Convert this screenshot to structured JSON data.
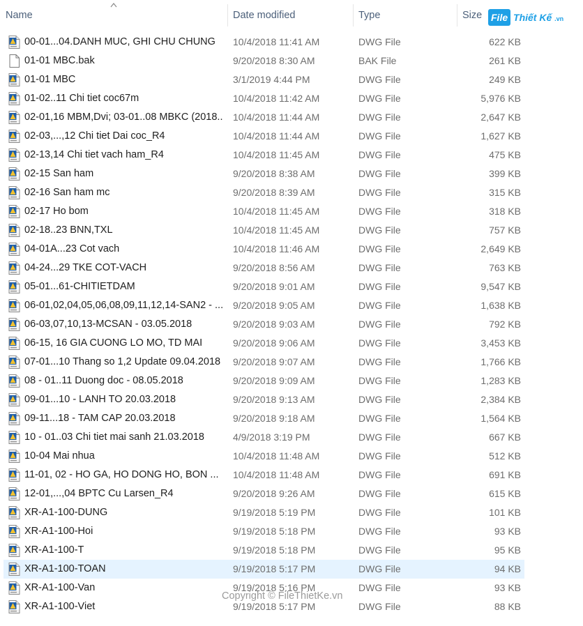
{
  "columns": {
    "name": "Name",
    "date": "Date modified",
    "type": "Type",
    "size": "Size"
  },
  "watermark": {
    "badge": "File",
    "text": "Thiết Kế",
    "tld": ".vn"
  },
  "copyright": "Copyright © FileThietKe.vn",
  "files": [
    {
      "name": "00-01...04.DANH MUC, GHI CHU CHUNG",
      "date": "10/4/2018 11:41 AM",
      "type": "DWG File",
      "size": "622 KB",
      "icon": "dwg-icon"
    },
    {
      "name": "01-01 MBC.bak",
      "date": "9/20/2018 8:30 AM",
      "type": "BAK File",
      "size": "261 KB",
      "icon": "blank-file-icon"
    },
    {
      "name": "01-01 MBC",
      "date": "3/1/2019 4:44 PM",
      "type": "DWG File",
      "size": "249 KB",
      "icon": "dwg-icon"
    },
    {
      "name": "01-02..11 Chi tiet coc67m",
      "date": "10/4/2018 11:42 AM",
      "type": "DWG File",
      "size": "5,976 KB",
      "icon": "dwg-icon"
    },
    {
      "name": "02-01,16 MBM,Dvi; 03-01..08 MBKC (2018...",
      "date": "10/4/2018 11:44 AM",
      "type": "DWG File",
      "size": "2,647 KB",
      "icon": "dwg-icon"
    },
    {
      "name": "02-03,...,12 Chi tiet Dai coc_R4",
      "date": "10/4/2018 11:44 AM",
      "type": "DWG File",
      "size": "1,627 KB",
      "icon": "dwg-icon"
    },
    {
      "name": "02-13,14 Chi tiet vach ham_R4",
      "date": "10/4/2018 11:45 AM",
      "type": "DWG File",
      "size": "475 KB",
      "icon": "dwg-icon"
    },
    {
      "name": "02-15 San ham",
      "date": "9/20/2018 8:38 AM",
      "type": "DWG File",
      "size": "399 KB",
      "icon": "dwg-icon"
    },
    {
      "name": "02-16 San ham mc",
      "date": "9/20/2018 8:39 AM",
      "type": "DWG File",
      "size": "315 KB",
      "icon": "dwg-icon"
    },
    {
      "name": "02-17 Ho bom",
      "date": "10/4/2018 11:45 AM",
      "type": "DWG File",
      "size": "318 KB",
      "icon": "dwg-icon"
    },
    {
      "name": "02-18..23 BNN,TXL",
      "date": "10/4/2018 11:45 AM",
      "type": "DWG File",
      "size": "757 KB",
      "icon": "dwg-icon"
    },
    {
      "name": "04-01A...23 Cot vach",
      "date": "10/4/2018 11:46 AM",
      "type": "DWG File",
      "size": "2,649 KB",
      "icon": "dwg-icon"
    },
    {
      "name": "04-24...29 TKE COT-VACH",
      "date": "9/20/2018 8:56 AM",
      "type": "DWG File",
      "size": "763 KB",
      "icon": "dwg-icon"
    },
    {
      "name": "05-01...61-CHITIETDAM",
      "date": "9/20/2018 9:01 AM",
      "type": "DWG File",
      "size": "9,547 KB",
      "icon": "dwg-icon"
    },
    {
      "name": "06-01,02,04,05,06,08,09,11,12,14-SAN2 - ...",
      "date": "9/20/2018 9:05 AM",
      "type": "DWG File",
      "size": "1,638 KB",
      "icon": "dwg-icon"
    },
    {
      "name": "06-03,07,10,13-MCSAN - 03.05.2018",
      "date": "9/20/2018 9:03 AM",
      "type": "DWG File",
      "size": "792 KB",
      "icon": "dwg-icon"
    },
    {
      "name": "06-15, 16 GIA CUONG LO MO, TD MAI",
      "date": "9/20/2018 9:06 AM",
      "type": "DWG File",
      "size": "3,453 KB",
      "icon": "dwg-icon"
    },
    {
      "name": "07-01...10 Thang so 1,2 Update 09.04.2018",
      "date": "9/20/2018 9:07 AM",
      "type": "DWG File",
      "size": "1,766 KB",
      "icon": "dwg-icon"
    },
    {
      "name": "08 - 01..11 Duong doc - 08.05.2018",
      "date": "9/20/2018 9:09 AM",
      "type": "DWG File",
      "size": "1,283 KB",
      "icon": "dwg-icon"
    },
    {
      "name": "09-01...10 - LANH TO 20.03.2018",
      "date": "9/20/2018 9:13 AM",
      "type": "DWG File",
      "size": "2,384 KB",
      "icon": "dwg-icon"
    },
    {
      "name": "09-11...18 - TAM CAP 20.03.2018",
      "date": "9/20/2018 9:18 AM",
      "type": "DWG File",
      "size": "1,564 KB",
      "icon": "dwg-icon"
    },
    {
      "name": "10 - 01..03 Chi tiet mai sanh 21.03.2018",
      "date": "4/9/2018 3:19 PM",
      "type": "DWG File",
      "size": "667 KB",
      "icon": "dwg-icon"
    },
    {
      "name": "10-04 Mai nhua",
      "date": "10/4/2018 11:48 AM",
      "type": "DWG File",
      "size": "512 KB",
      "icon": "dwg-icon"
    },
    {
      "name": "11-01, 02 - HO GA, HO DONG HO, BON ...",
      "date": "10/4/2018 11:48 AM",
      "type": "DWG File",
      "size": "691 KB",
      "icon": "dwg-icon"
    },
    {
      "name": "12-01,...,04 BPTC Cu Larsen_R4",
      "date": "9/20/2018 9:26 AM",
      "type": "DWG File",
      "size": "615 KB",
      "icon": "dwg-icon"
    },
    {
      "name": "XR-A1-100-DUNG",
      "date": "9/19/2018 5:19 PM",
      "type": "DWG File",
      "size": "101 KB",
      "icon": "dwg-icon"
    },
    {
      "name": "XR-A1-100-Hoi",
      "date": "9/19/2018 5:18 PM",
      "type": "DWG File",
      "size": "93 KB",
      "icon": "dwg-icon"
    },
    {
      "name": "XR-A1-100-T",
      "date": "9/19/2018 5:18 PM",
      "type": "DWG File",
      "size": "95 KB",
      "icon": "dwg-icon"
    },
    {
      "name": "XR-A1-100-TOAN",
      "date": "9/19/2018 5:17 PM",
      "type": "DWG File",
      "size": "94 KB",
      "icon": "dwg-icon",
      "selected": true
    },
    {
      "name": "XR-A1-100-Van",
      "date": "9/19/2018 5:16 PM",
      "type": "DWG File",
      "size": "93 KB",
      "icon": "dwg-icon"
    },
    {
      "name": "XR-A1-100-Viet",
      "date": "9/19/2018 5:17 PM",
      "type": "DWG File",
      "size": "88 KB",
      "icon": "dwg-icon"
    }
  ]
}
